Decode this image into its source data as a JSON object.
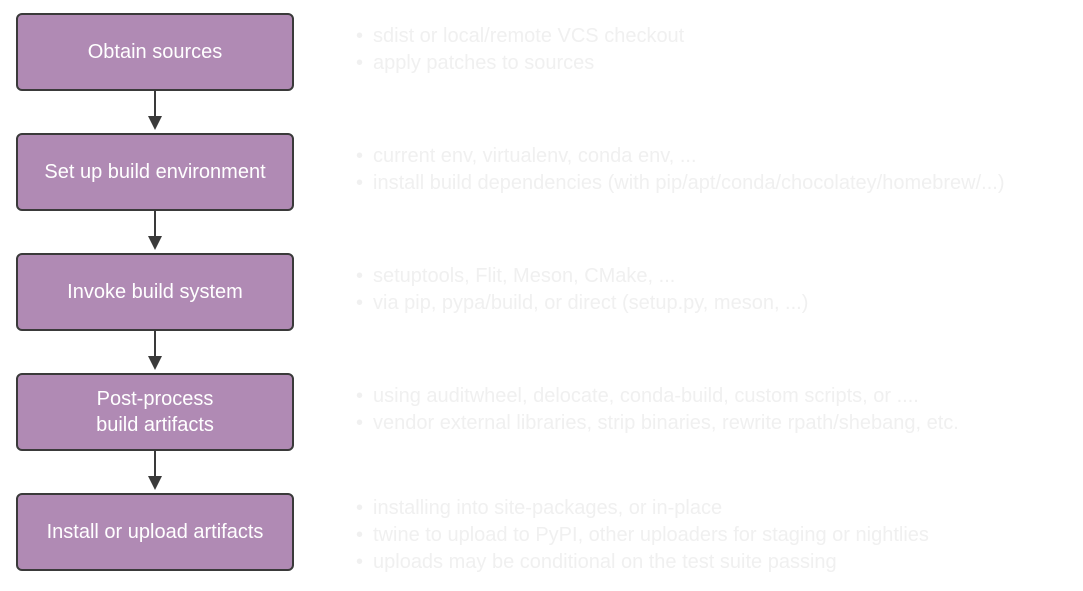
{
  "steps": [
    {
      "label": "Obtain sources",
      "notes": [
        "sdist or local/remote VCS checkout",
        "apply patches to sources"
      ]
    },
    {
      "label": "Set up build environment",
      "notes": [
        "current env, virtualenv, conda env, ...",
        "install build dependencies (with pip/apt/conda/chocolatey/homebrew/...)"
      ]
    },
    {
      "label": "Invoke build system",
      "notes": [
        "setuptools, Flit, Meson, CMake, ...",
        "via pip, pypa/build, or direct (setup.py, meson, ...)"
      ]
    },
    {
      "label": "Post-process\nbuild artifacts",
      "notes": [
        "using auditwheel, delocate, conda-build, custom scripts, or ....",
        "vendor external libraries, strip binaries, rewrite rpath/shebang, etc."
      ]
    },
    {
      "label": "Install or upload artifacts",
      "notes": [
        "installing into site-packages, or in-place",
        "twine to upload to PyPI, other uploaders for staging or nightlies",
        "uploads may be conditional on the test suite passing"
      ]
    }
  ],
  "colors": {
    "box_fill": "#b08ab4",
    "box_border": "#3a3a3a",
    "box_text": "#ffffff",
    "note_text": "#f0f0f0"
  }
}
